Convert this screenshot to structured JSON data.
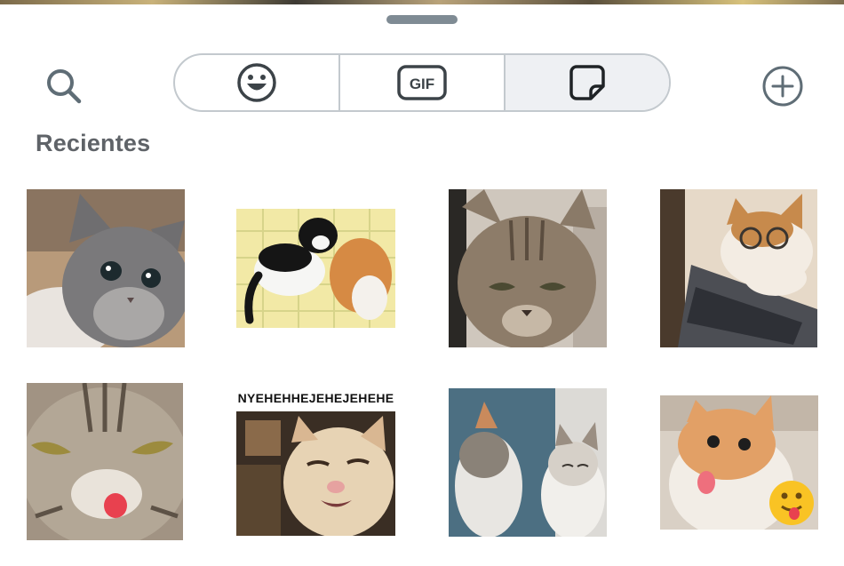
{
  "panel": {
    "title": "Recientes"
  },
  "tabs": [
    {
      "name": "emoji",
      "icon": "smiley-face-icon",
      "active": false
    },
    {
      "name": "gif",
      "label": "GIF",
      "icon": "gif-icon",
      "active": false
    },
    {
      "name": "stickers",
      "icon": "sticker-icon",
      "active": true
    }
  ],
  "toolbar": {
    "search_icon": "search-icon",
    "add_icon": "plus-circle-icon"
  },
  "stickers": [
    {
      "id": 1,
      "caption": "",
      "subject": "grey kitten looking up"
    },
    {
      "id": 2,
      "caption": "",
      "subject": "black-and-white cat hugging orange cat"
    },
    {
      "id": 3,
      "caption": "",
      "subject": "grumpy tabby cat"
    },
    {
      "id": 4,
      "caption": "",
      "subject": "cat with glasses at laptop"
    },
    {
      "id": 5,
      "caption": "",
      "subject": "tabby kitten sticking out tongue"
    },
    {
      "id": 6,
      "caption": "NYEHEHHEJEHEJEHEHE",
      "subject": "cream cat laughing"
    },
    {
      "id": 7,
      "caption": "",
      "subject": "two cats hugging"
    },
    {
      "id": 8,
      "caption": "",
      "subject": "orange cat with tongue out and emoji"
    }
  ],
  "colors": {
    "icon": "#5f6d76",
    "border": "#c3c9ce",
    "active_tab": "#eef0f3",
    "title": "#5f6368"
  }
}
